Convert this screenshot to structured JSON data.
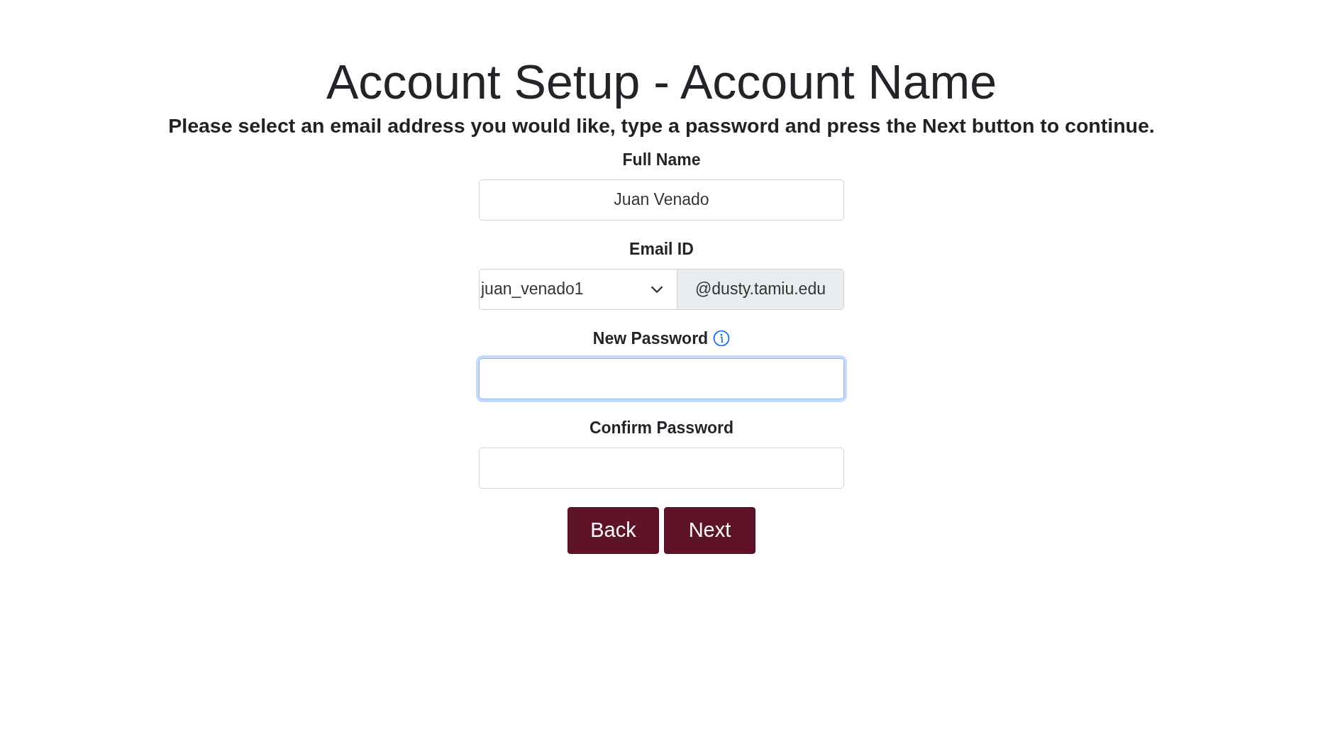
{
  "title": "Account Setup - Account Name",
  "instructions": "Please select an email address you would like, type a password and press the Next button to continue.",
  "fields": [
    {
      "kind": "text",
      "label": "Full Name",
      "value": "Juan Venado",
      "focused": false
    },
    {
      "kind": "email",
      "label": "Email ID",
      "value": "juan_venado1",
      "suffix": "@dusty.tamiu.edu",
      "focused": false
    },
    {
      "kind": "password",
      "label": "New Password",
      "info": true,
      "focused": true
    },
    {
      "kind": "password",
      "label": "Confirm Password",
      "info": false,
      "focused": false
    }
  ],
  "buttons": [
    {
      "label": "Back"
    },
    {
      "label": "Next"
    }
  ]
}
